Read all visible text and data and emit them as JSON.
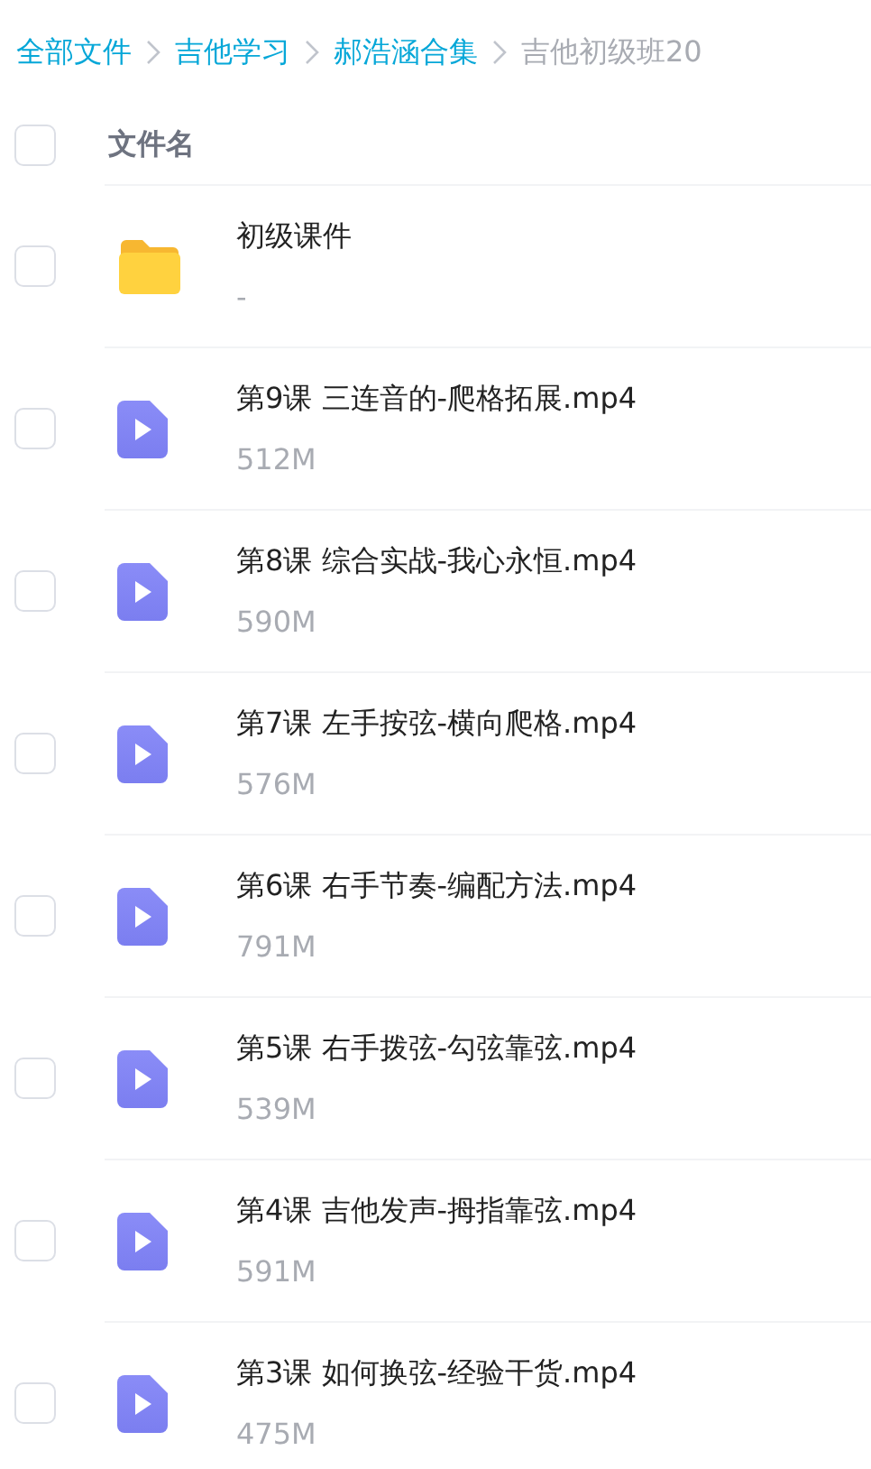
{
  "breadcrumb": [
    {
      "label": "全部文件",
      "current": false
    },
    {
      "label": "吉他学习",
      "current": false
    },
    {
      "label": "郝浩涵合集",
      "current": false
    },
    {
      "label": "吉他初级班20",
      "current": true
    }
  ],
  "header": {
    "label": "文件名",
    "checked": false
  },
  "files": [
    {
      "kind": "folder",
      "name": "初级课件",
      "size": "-",
      "checked": false
    },
    {
      "kind": "video",
      "name": "第9课 三连音的-爬格拓展.mp4",
      "size": "512M",
      "checked": false
    },
    {
      "kind": "video",
      "name": "第8课 综合实战-我心永恒.mp4",
      "size": "590M",
      "checked": false
    },
    {
      "kind": "video",
      "name": "第7课 左手按弦-横向爬格.mp4",
      "size": "576M",
      "checked": false
    },
    {
      "kind": "video",
      "name": "第6课 右手节奏-编配方法.mp4",
      "size": "791M",
      "checked": false
    },
    {
      "kind": "video",
      "name": "第5课 右手拨弦-勾弦靠弦.mp4",
      "size": "539M",
      "checked": false
    },
    {
      "kind": "video",
      "name": "第4课 吉他发声-拇指靠弦.mp4",
      "size": "591M",
      "checked": false
    },
    {
      "kind": "video",
      "name": "第3课 如何换弦-经验干货.mp4",
      "size": "475M",
      "checked": false
    }
  ]
}
